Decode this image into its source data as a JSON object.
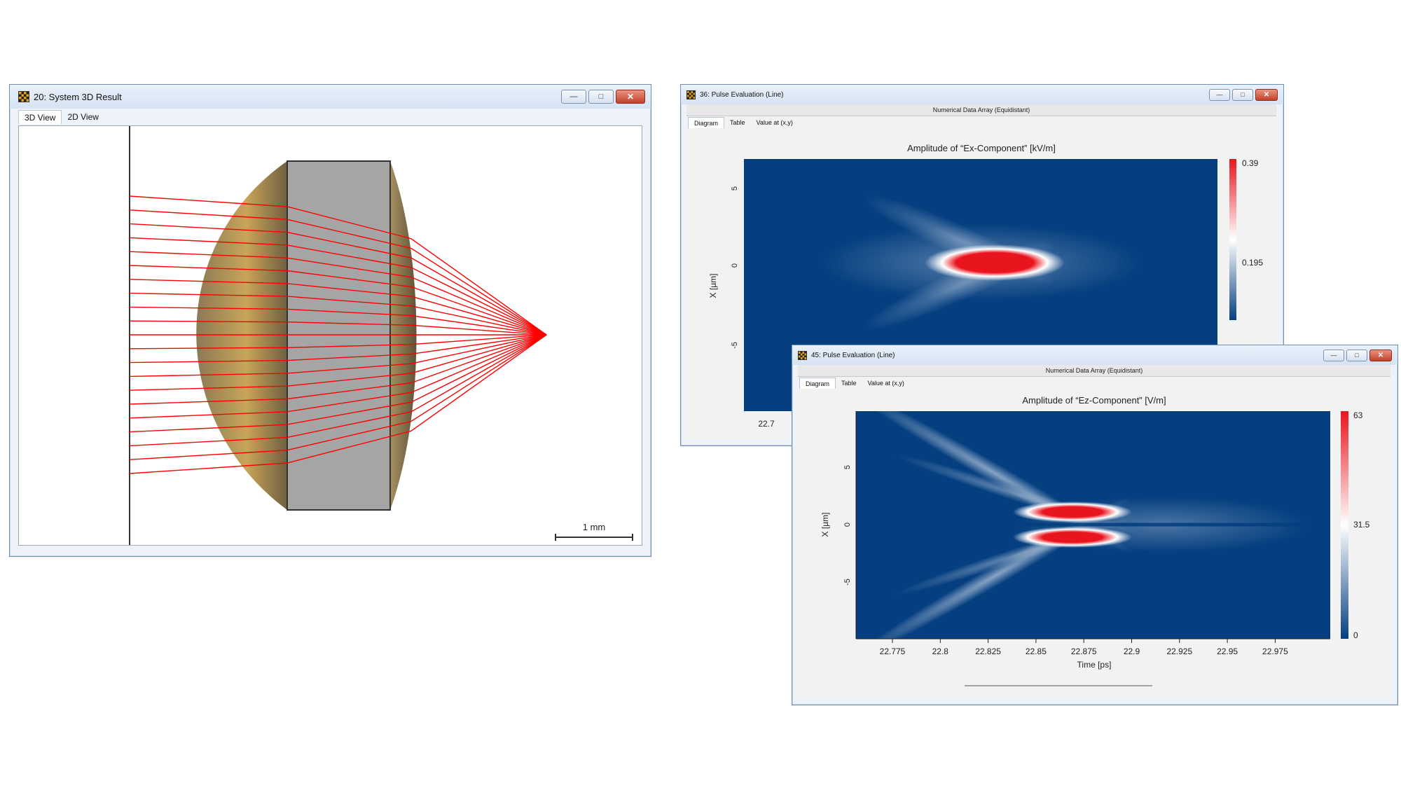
{
  "win1": {
    "title": "20: System 3D Result",
    "tabs": [
      "3D View",
      "2D View"
    ],
    "scale_label": "1 mm"
  },
  "win2": {
    "title": "36: Pulse Evaluation (Line)",
    "subheader": "Numerical Data Array (Equidistant)",
    "tabs": [
      "Diagram",
      "Table",
      "Value at (x,y)"
    ],
    "plot_title": "Amplitude of “Ex-Component”  [kV/m]",
    "ylabel": "X [µm]",
    "visible_x_tick": "22.7",
    "colorbar": {
      "max": "0.39",
      "mid": "0.195"
    }
  },
  "win3": {
    "title": "45: Pulse Evaluation (Line)",
    "subheader": "Numerical Data Array (Equidistant)",
    "tabs": [
      "Diagram",
      "Table",
      "Value at (x,y)"
    ],
    "plot_title": "Amplitude of “Ez-Component”  [V/m]",
    "ylabel": "X [µm]",
    "xlabel": "Time [ps]",
    "xticks": [
      "22.775",
      "22.8",
      "22.825",
      "22.85",
      "22.875",
      "22.9",
      "22.925",
      "22.95",
      "22.975"
    ],
    "yticks": [
      "5",
      "0",
      "-5"
    ],
    "colorbar": {
      "max": "63",
      "mid": "31.5",
      "min": "0"
    }
  },
  "colors": {
    "ray": "#ff0000",
    "map_low": "#053f80",
    "map_mid": "#ffffff",
    "map_high": "#e8141e"
  }
}
